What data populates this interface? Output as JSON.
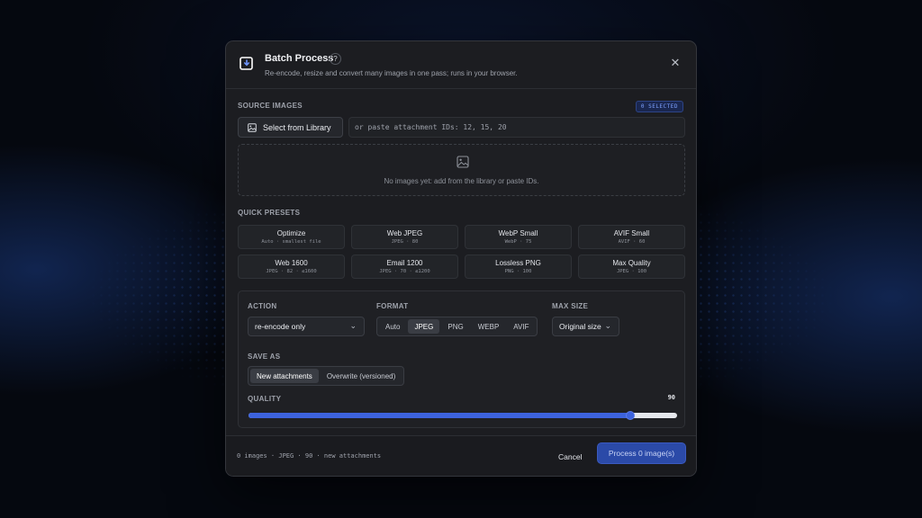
{
  "dialog": {
    "title": "Batch Process",
    "help": "?",
    "subtitle": "Re-encode, resize and convert many images in one pass; runs in your browser.",
    "close": "✕"
  },
  "source": {
    "label": "SOURCE IMAGES",
    "selected_badge": "0 SELECTED",
    "library_button": "Select from Library",
    "ids_placeholder": "or paste attachment IDs: 12, 15, 20",
    "empty_text": "No images yet: add from the library or paste IDs."
  },
  "presets": {
    "label": "QUICK PRESETS",
    "items": [
      {
        "name": "Optimize",
        "desc": "Auto · smallest file"
      },
      {
        "name": "Web JPEG",
        "desc": "JPEG · 80"
      },
      {
        "name": "WebP Small",
        "desc": "WebP · 75"
      },
      {
        "name": "AVIF Small",
        "desc": "AVIF · 60"
      },
      {
        "name": "Web 1600",
        "desc": "JPEG · 82 · ≤1600"
      },
      {
        "name": "Email 1200",
        "desc": "JPEG · 70 · ≤1200"
      },
      {
        "name": "Lossless PNG",
        "desc": "PNG · 100"
      },
      {
        "name": "Max Quality",
        "desc": "JPEG · 100"
      }
    ]
  },
  "settings": {
    "action_label": "ACTION",
    "action_value": "re-encode only",
    "format_label": "FORMAT",
    "formats": [
      "Auto",
      "JPEG",
      "PNG",
      "WEBP",
      "AVIF"
    ],
    "format_selected": "JPEG",
    "maxsize_label": "MAX SIZE",
    "maxsize_value": "Original size",
    "saveas_label": "SAVE AS",
    "saveas_options": [
      "New attachments",
      "Overwrite (versioned)"
    ],
    "saveas_selected": "New attachments",
    "quality_label": "QUALITY",
    "quality_value": 90,
    "quality_fraction": 0.89
  },
  "footer": {
    "summary": "0 images · JPEG · 90 · new attachments",
    "cancel": "Cancel",
    "process": "Process 0 image(s)"
  },
  "colors": {
    "accent": "#3d63dd",
    "dialog_bg": "#1c1d21",
    "badge_text": "#7ea2ff"
  }
}
